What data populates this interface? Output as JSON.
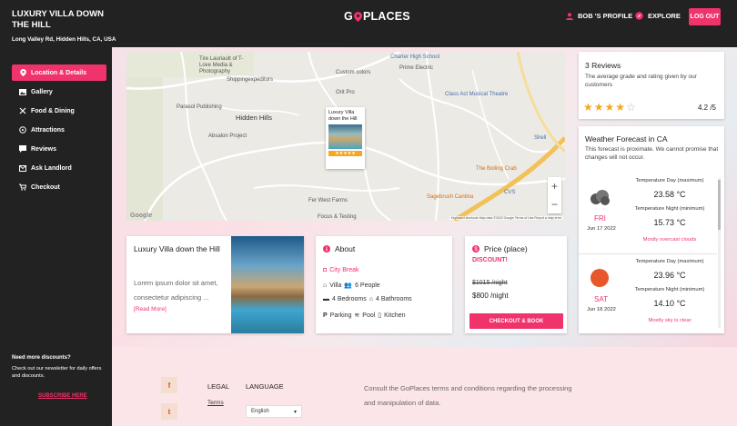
{
  "header": {
    "property_title": "LUXURY VILLA DOWN THE HILL",
    "property_address": "Long Valley Rd, Hidden Hills, CA, USA",
    "logo_prefix": "G",
    "logo_suffix": "PLACES",
    "profile_label": "BOB 'S PROFILE",
    "explore_label": "EXPLORE",
    "logout_label": "LOG OUT"
  },
  "sidebar": {
    "items": [
      {
        "label": "Location & Details",
        "icon": "location-pin-icon",
        "active": true
      },
      {
        "label": "Gallery",
        "icon": "gallery-icon"
      },
      {
        "label": "Food & Dining",
        "icon": "cutlery-icon"
      },
      {
        "label": "Attractions",
        "icon": "attractions-icon"
      },
      {
        "label": "Reviews",
        "icon": "reviews-icon"
      },
      {
        "label": "Ask Landlord",
        "icon": "mail-icon"
      },
      {
        "label": "Checkout",
        "icon": "cart-icon"
      }
    ],
    "promo_title": "Need more discounts?",
    "promo_text": "Check out our newsletter for daily offers and discounts.",
    "subscribe_label": "SUBSCRIBE HERE"
  },
  "map": {
    "labels": {
      "tire": "Tire Lauriault of T-Love Media & Photography",
      "charter": "Charter High School",
      "custom_colors": "Custom colors",
      "prime": "Prime Electric",
      "shipping": "Shippingexpeditors",
      "orit": "Orit Pro",
      "class_act": "Class Act Musical Theatre",
      "parasol": "Parasol Publishing",
      "hidden_hills": "Hidden Hills",
      "absalon": "Absalon Project",
      "boiling_crab": "The Boiling Crab",
      "shell": "Shell",
      "cvs": "CVS",
      "fer_west": "Fer West Farms",
      "sagebrush": "Sagebrush Cantina",
      "focus": "Focus & Testing",
      "google": "Google",
      "attribution": "Keyboard shortcuts  Map data ©2022 Google  Terms of Use  Report a map error",
      "zoom_in": "+",
      "zoom_out": "−"
    },
    "popup_title": "Luxury Villa down the Hill"
  },
  "villa": {
    "title": "Luxury Villa down the Hill",
    "description": "Lorem ipsum dolor sit amet, consectetur adipiscing ...",
    "read_more": "[Read More]"
  },
  "about": {
    "title": "About",
    "type": "City Break",
    "category": "Villa",
    "people": "6 People",
    "bedrooms": "4 Bedrooms",
    "bathrooms": "4 Bathrooms",
    "parking": "Parking",
    "pool": "Pool",
    "kitchen": "Kitchen"
  },
  "price": {
    "title": "Price (place)",
    "discount": "DISCOUNT!",
    "old_price": "$1015 /night",
    "new_price": "$800 /night",
    "checkout_label": "CHECKOUT & BOOK"
  },
  "reviews": {
    "title": "3 Reviews",
    "subtitle": "The average grade and rating given by our customers",
    "stars_filled": 4,
    "stars_total": 5,
    "rating": "4.2 /5"
  },
  "weather": {
    "title": "Weather Forecast in CA",
    "subtitle": "This forecast is proximate. We cannot promise that changes will not occur.",
    "days": [
      {
        "dow": "FRI",
        "date": "Jun 17 2022",
        "max_label": "Temperature Day (maximum)",
        "max": "23.58 °C",
        "min_label": "Temperature Night (minimum)",
        "min": "15.73 °C",
        "desc": "Mostly overcast clouds",
        "icon": "cloud-icon"
      },
      {
        "dow": "SAT",
        "date": "Jun 18 2022",
        "max_label": "Temperature Day (maximum)",
        "max": "23.96 °C",
        "min_label": "Temperature Night (minimum)",
        "min": "14.10 °C",
        "desc": "Mostly sky is clear",
        "icon": "sun-icon"
      }
    ]
  },
  "footer": {
    "legal_heading": "LEGAL",
    "legal_link": "Terms",
    "language_heading": "LANGUAGE",
    "language_value": "English",
    "terms_text": "Consult the GoPlaces terms and conditions regarding the processing and manipulation of data."
  },
  "colors": {
    "accent": "#f0336b",
    "dark": "#222222",
    "star": "#f5a623"
  }
}
